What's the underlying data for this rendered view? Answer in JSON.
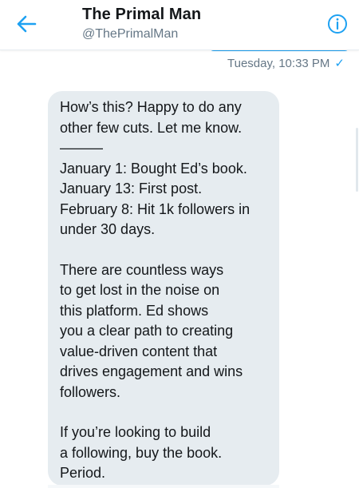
{
  "header": {
    "back_icon": "back-arrow-icon",
    "title": "The Primal Man",
    "handle": "@ThePrimalMan",
    "info_icon": "info-icon"
  },
  "conversation": {
    "sent_timestamp": "Tuesday, 10:33 PM",
    "sent_status": "✓",
    "received_message": {
      "paragraph_1": "How’s this? Happy to do any\nother few cuts. Let me know.\n———\nJanuary 1: Bought Ed’s book.\nJanuary 13: First post.\nFebruary 8: Hit 1k followers in\nunder 30 days.",
      "paragraph_2": "There are countless ways\nto get lost in the noise on\nthis platform. Ed shows\nyou a clear path to creating\nvalue-driven content that\ndrives engagement and wins\nfollowers.",
      "paragraph_3": "If you’re looking to build\na following, buy the book.\nPeriod."
    }
  },
  "colors": {
    "accent": "#1da1f2",
    "bubble_bg": "#e6ecf0",
    "secondary_text": "#657786"
  }
}
